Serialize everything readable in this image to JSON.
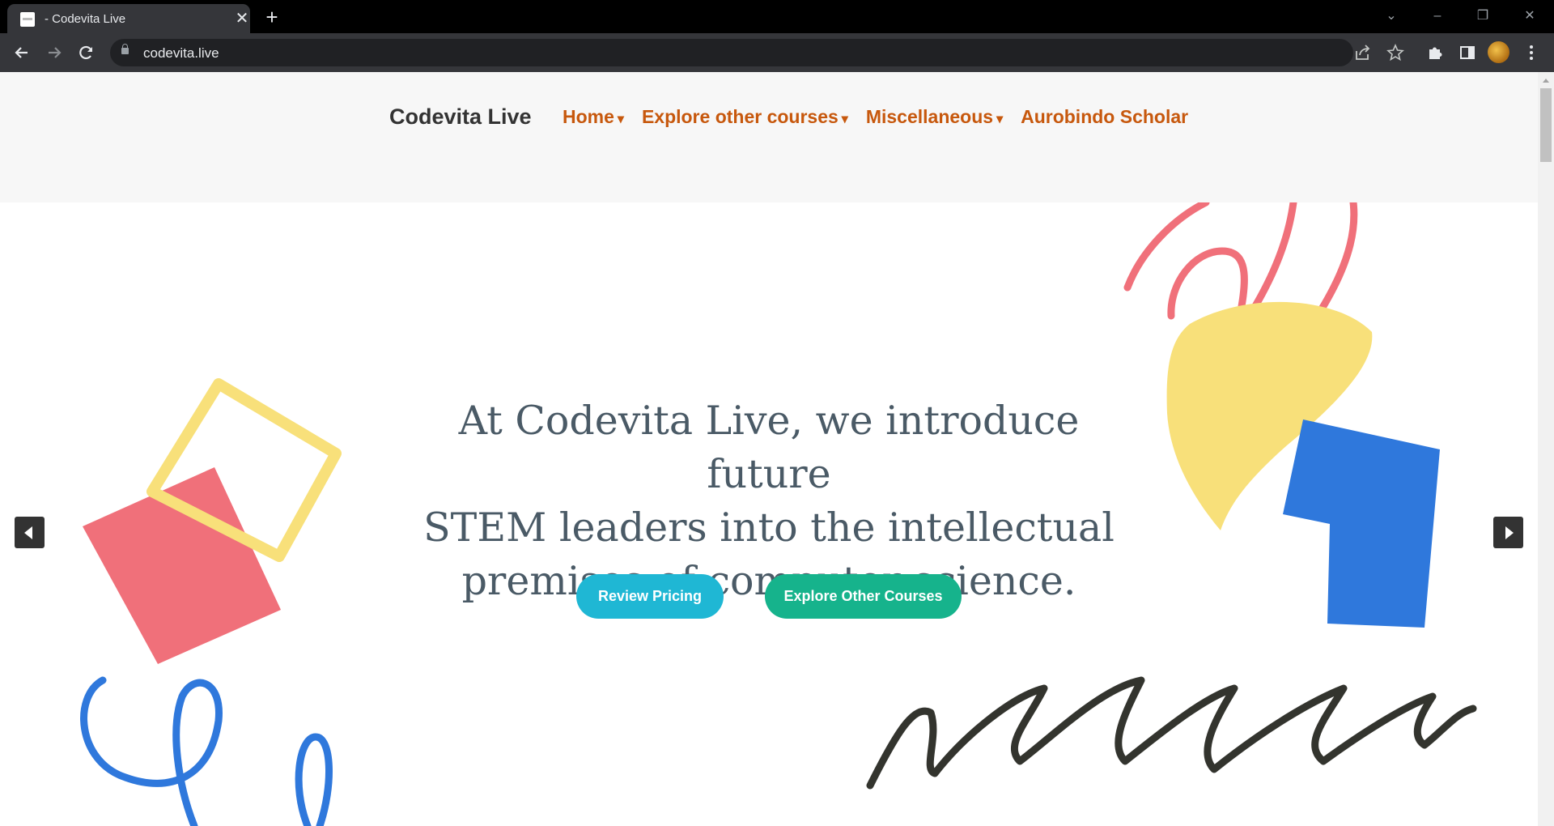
{
  "browser": {
    "tab_title": "- Codevita Live",
    "url": "codevita.live",
    "icons": {
      "back": "back-arrow-icon",
      "forward": "forward-arrow-icon",
      "reload": "reload-icon",
      "share": "share-icon",
      "bookmark": "star-icon",
      "extensions": "puzzle-icon",
      "sidepanel": "side-panel-icon",
      "menu": "kebab-menu-icon"
    }
  },
  "header": {
    "brand": "Codevita Live",
    "nav": [
      {
        "label": "Home",
        "caret": "▾"
      },
      {
        "label": "Explore other courses",
        "caret": "▾"
      },
      {
        "label": "Miscellaneous",
        "caret": "▾"
      },
      {
        "label": "Aurobindo Scholar",
        "caret": ""
      }
    ]
  },
  "hero": {
    "headline_lines": [
      "At Codevita Live, we introduce future",
      "STEM leaders into the intellectual",
      "premises of computer science."
    ],
    "primary_button": "Review Pricing",
    "secondary_button": "Explore Other Courses"
  },
  "colors": {
    "nav_link": "#c7580d",
    "pricing_button": "#1fb7d4",
    "courses_button": "#16b38c",
    "deco_red": "#f0707a",
    "deco_yellow": "#f8e07a",
    "deco_blue": "#2f78dc",
    "deco_dark": "#33342e"
  }
}
